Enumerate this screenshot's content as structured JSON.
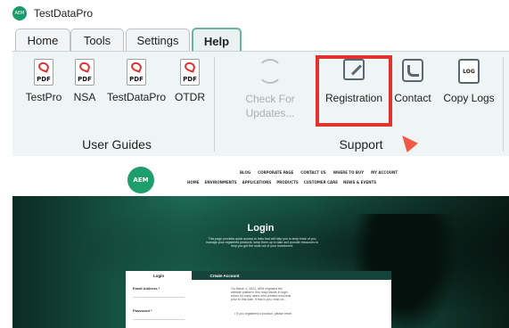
{
  "app": {
    "title": "TestDataPro",
    "logo_text": "AEM"
  },
  "tabs": [
    {
      "label": "Home",
      "active": false
    },
    {
      "label": "Tools",
      "active": false
    },
    {
      "label": "Settings",
      "active": false
    },
    {
      "label": "Help",
      "active": true
    }
  ],
  "ribbon": {
    "user_guides": {
      "label": "User Guides",
      "icon_text": "PDF",
      "buttons": [
        {
          "label": "TestPro",
          "icon": "pdf-icon"
        },
        {
          "label": "NSA",
          "icon": "pdf-icon"
        },
        {
          "label": "TestDataPro",
          "icon": "pdf-icon"
        },
        {
          "label": "OTDR",
          "icon": "pdf-icon"
        }
      ]
    },
    "support": {
      "label": "Support",
      "check_updates": {
        "line1": "Check For",
        "line2": "Updates...",
        "icon": "sync-icon",
        "enabled": false
      },
      "registration": {
        "label": "Registration",
        "icon": "pencil-icon",
        "highlighted": true
      },
      "contact": {
        "label": "Contact",
        "icon": "phone-icon"
      },
      "copy_logs": {
        "label": "Copy Logs",
        "icon": "log-icon",
        "icon_text": "LOG"
      }
    },
    "highlight_color": "#e0332f"
  },
  "website": {
    "logo_text": "AEM",
    "top_links": [
      "BLOG",
      "CORPORATE PAGE",
      "CONTACT US",
      "WHERE TO BUY",
      "MY ACCOUNT"
    ],
    "main_links": [
      "HOME",
      "ENVIRONMENTS",
      "APPLICATIONS",
      "PRODUCTS",
      "CUSTOMER CARE",
      "NEWS & EVENTS"
    ],
    "hero_title": "Login",
    "hero_desc": "This page provides quick access to links that will help you to keep track of you manage your registered products, keep them up to date and provide resources to help you get the most out of your investment.",
    "card_tabs": [
      "Login",
      "Create Account"
    ],
    "email_label": "Email Address *",
    "password_label": "Password *",
    "notice": "On March 1, 2021, AEM migrated the website platform, this may results in login errors for early users who created accounts prior to this date. If this is you, read on...",
    "notice_bullet": "• If you registered a product, please reset"
  }
}
